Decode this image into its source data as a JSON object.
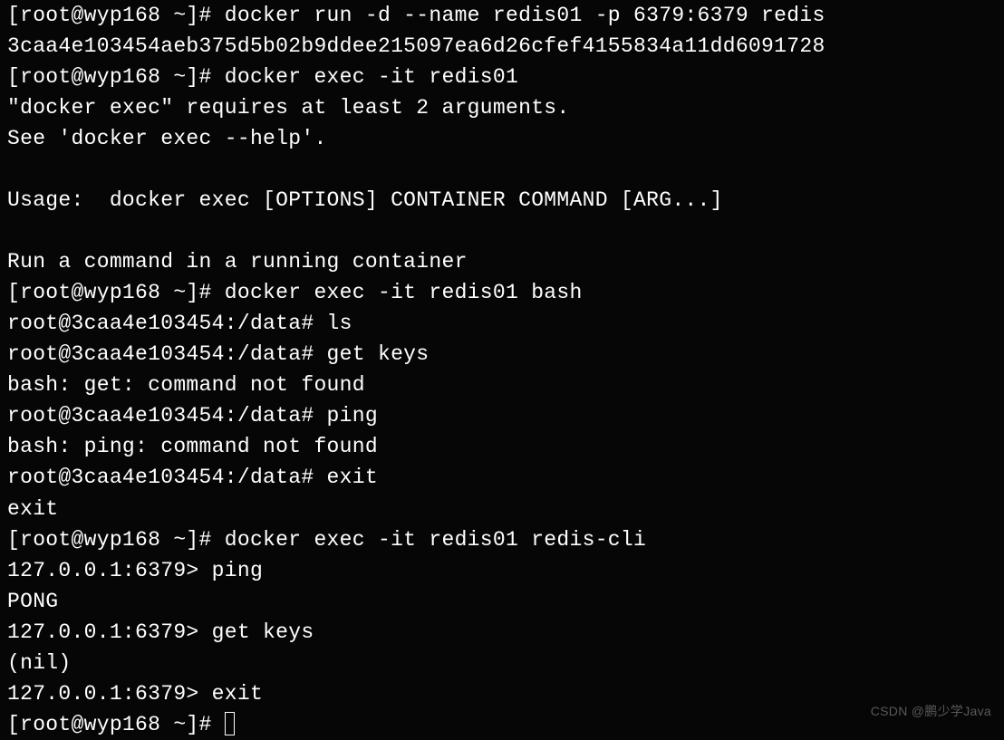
{
  "lines": {
    "l0": "[root@wyp168 ~]# docker run -d --name redis01 -p 6379:6379 redis",
    "l1": "3caa4e103454aeb375d5b02b9ddee215097ea6d26cfef4155834a11dd6091728",
    "l2": "[root@wyp168 ~]# docker exec -it redis01",
    "l3": "\"docker exec\" requires at least 2 arguments.",
    "l4": "See 'docker exec --help'.",
    "l5": "",
    "l6": "Usage:  docker exec [OPTIONS] CONTAINER COMMAND [ARG...]",
    "l7": "",
    "l8": "Run a command in a running container",
    "l9": "[root@wyp168 ~]# docker exec -it redis01 bash",
    "l10": "root@3caa4e103454:/data# ls",
    "l11": "root@3caa4e103454:/data# get keys",
    "l12": "bash: get: command not found",
    "l13": "root@3caa4e103454:/data# ping",
    "l14": "bash: ping: command not found",
    "l15": "root@3caa4e103454:/data# exit",
    "l16": "exit",
    "l17": "[root@wyp168 ~]# docker exec -it redis01 redis-cli",
    "l18": "127.0.0.1:6379> ping",
    "l19": "PONG",
    "l20": "127.0.0.1:6379> get keys",
    "l21": "(nil)",
    "l22": "127.0.0.1:6379> exit",
    "l23": "[root@wyp168 ~]# "
  },
  "watermark": "CSDN @鹏少学Java"
}
